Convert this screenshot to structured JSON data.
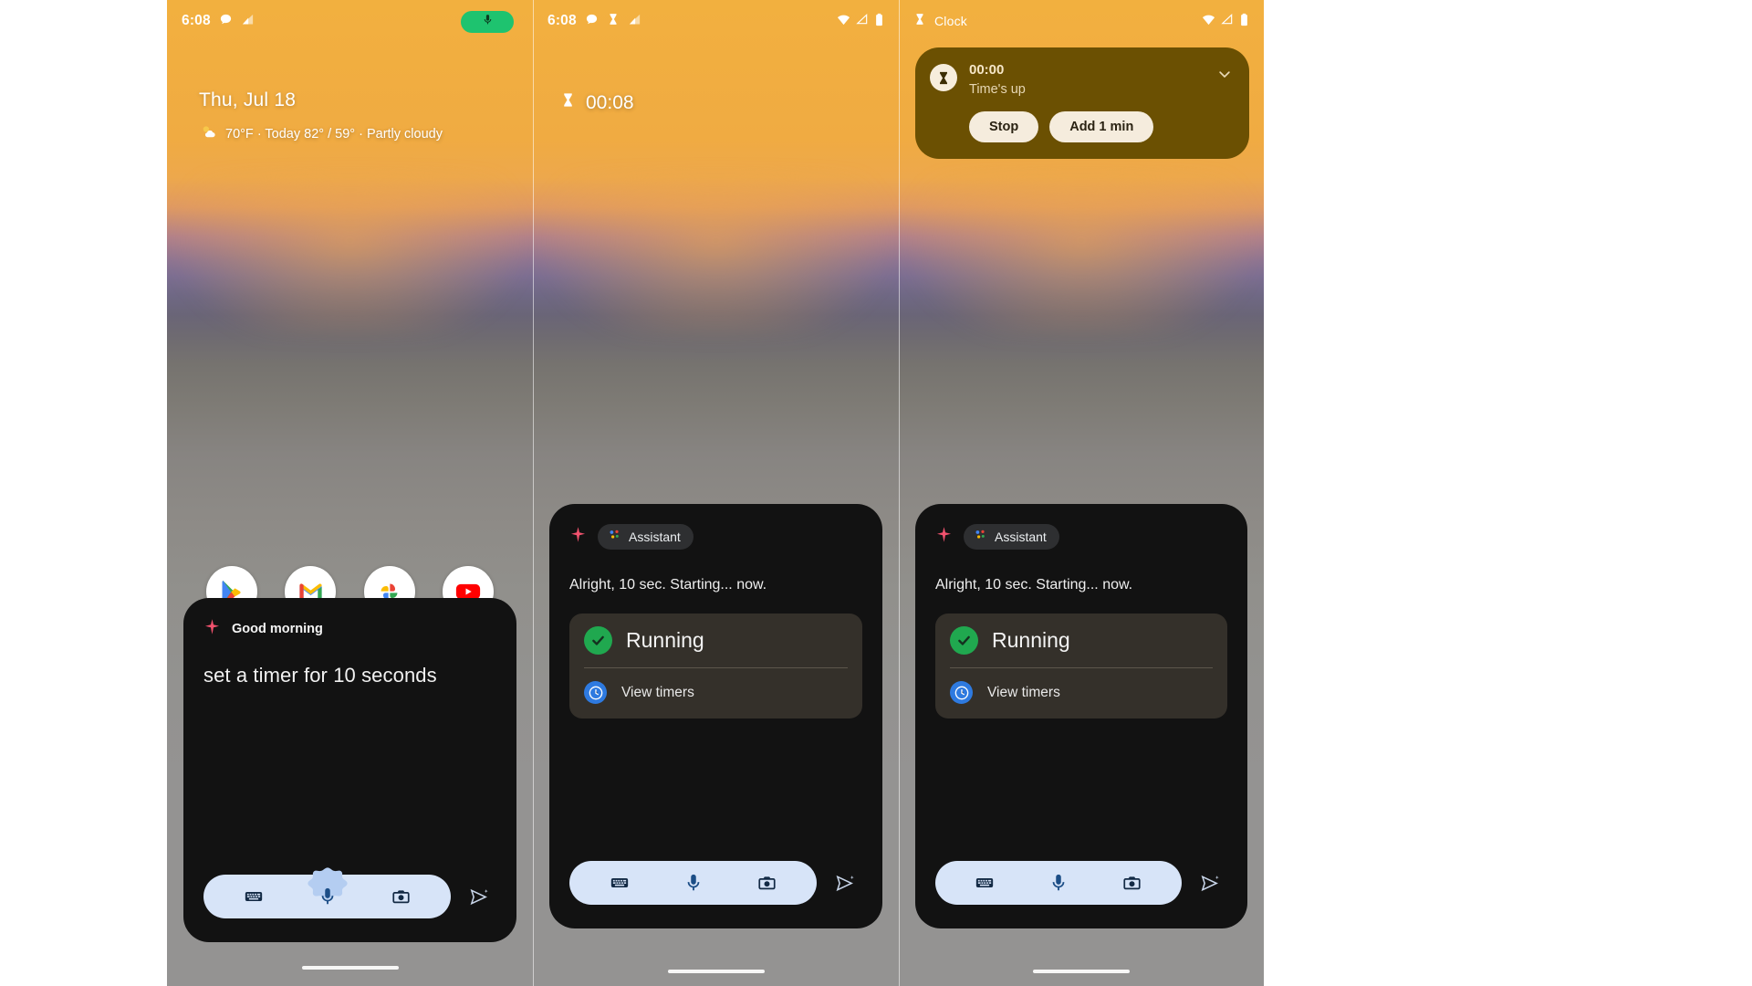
{
  "meta": {
    "description": "Three Android phone screenshots showing a Google Assistant 10-second timer flow"
  },
  "colors": {
    "accent_sparkle": "#f2526e",
    "mic_pill_green": "#1ec36f",
    "check_green": "#20a84f",
    "clock_blue": "#2e7ae0",
    "notification_bg": "#6b5002",
    "notification_button_bg": "#f5ecdd",
    "sheet_bg": "#121212",
    "result_card_bg": "#34302a",
    "input_pill_bg": "#d7e4f8",
    "wallpaper_top": "#f2b03f"
  },
  "panel1": {
    "status_bar": {
      "clock": "6:08",
      "icons": [
        "chat-bubble-icon",
        "signal-cellular-icon"
      ],
      "mic_pill_icon": "microphone-icon"
    },
    "at_a_glance": {
      "date": "Thu, Jul 18",
      "weather_icon": "partly-cloudy-sun-icon",
      "weather": "70°F  · Today 82° / 59° · Partly cloudy"
    },
    "dock": [
      {
        "name": "play-store",
        "icon": "play-store-icon"
      },
      {
        "name": "gmail",
        "icon": "gmail-icon"
      },
      {
        "name": "photos",
        "icon": "google-photos-icon"
      },
      {
        "name": "youtube",
        "icon": "youtube-icon"
      }
    ],
    "assistant": {
      "sparkle_icon": "sparkle-icon",
      "greeting": "Good morning",
      "query": "set a timer for 10 seconds",
      "input": {
        "keyboard_icon": "keyboard-icon",
        "mic_icon": "microphone-icon",
        "camera_icon": "camera-icon",
        "send_icon": "send-sparkle-icon"
      }
    }
  },
  "panel2": {
    "status_bar": {
      "clock": "6:08",
      "icons": [
        "chat-bubble-icon",
        "hourglass-icon",
        "signal-cellular-icon"
      ],
      "right_icons": [
        "wifi-icon",
        "signal-cellular-icon",
        "battery-icon"
      ]
    },
    "timer_overlay": {
      "icon": "hourglass-icon",
      "value": "00:08"
    },
    "assistant": {
      "sparkle_icon": "sparkle-icon",
      "chip_label": "Assistant",
      "chip_icon": "assistant-dots-icon",
      "reply": "Alright, 10 sec. Starting... now.",
      "result": {
        "status_icon": "check-circle-icon",
        "status": "Running",
        "link_icon": "clock-icon",
        "link": "View timers"
      },
      "input": {
        "keyboard_icon": "keyboard-icon",
        "mic_icon": "microphone-icon",
        "camera_icon": "camera-icon",
        "send_icon": "send-sparkle-icon"
      }
    }
  },
  "panel3": {
    "status_bar": {
      "app_icon": "hourglass-icon",
      "app_name": "Clock",
      "right_icons": [
        "wifi-icon",
        "signal-cellular-icon",
        "battery-icon"
      ]
    },
    "notification": {
      "icon": "hourglass-icon",
      "title": "00:00",
      "subtitle": "Time's up",
      "expand_icon": "chevron-down-icon",
      "buttons": [
        {
          "name": "stop",
          "label": "Stop"
        },
        {
          "name": "add-one-minute",
          "label": "Add 1 min"
        }
      ]
    },
    "assistant": {
      "sparkle_icon": "sparkle-icon",
      "chip_label": "Assistant",
      "chip_icon": "assistant-dots-icon",
      "reply": "Alright, 10 sec. Starting... now.",
      "result": {
        "status_icon": "check-circle-icon",
        "status": "Running",
        "link_icon": "clock-icon",
        "link": "View timers"
      },
      "input": {
        "keyboard_icon": "keyboard-icon",
        "mic_icon": "microphone-icon",
        "camera_icon": "camera-icon",
        "send_icon": "send-sparkle-icon"
      }
    }
  }
}
